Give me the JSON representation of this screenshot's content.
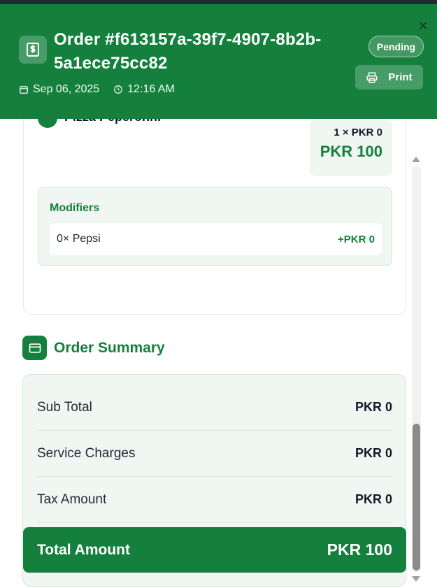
{
  "header": {
    "order_title": "Order #f613157a-39f7-4907-8b2b-5a1ece75cc82",
    "date": "Sep 06, 2025",
    "time": "12:16 AM",
    "status": "Pending",
    "print_label": "Print",
    "close_glyph": "×"
  },
  "item": {
    "name": "Pizza Peperonni",
    "qty_line": "1 × PKR 0",
    "total": "PKR 100",
    "modifiers_title": "Modifiers",
    "modifiers": [
      {
        "name": "0× Pepsi",
        "price": "+PKR 0"
      }
    ]
  },
  "summary": {
    "title": "Order Summary",
    "rows": [
      {
        "label": "Sub Total",
        "value": "PKR 0"
      },
      {
        "label": "Service Charges",
        "value": "PKR 0"
      },
      {
        "label": "Tax Amount",
        "value": "PKR 0"
      }
    ],
    "total_label": "Total Amount",
    "total_value": "PKR 100"
  },
  "colors": {
    "brand_green": "#15803d",
    "light_green_bg": "#f0f7f2"
  },
  "icons": {
    "order": "dollar-receipt-icon",
    "date": "calendar-icon",
    "time": "clock-icon",
    "print": "printer-icon",
    "summary": "credit-card-icon",
    "close": "close-icon"
  }
}
